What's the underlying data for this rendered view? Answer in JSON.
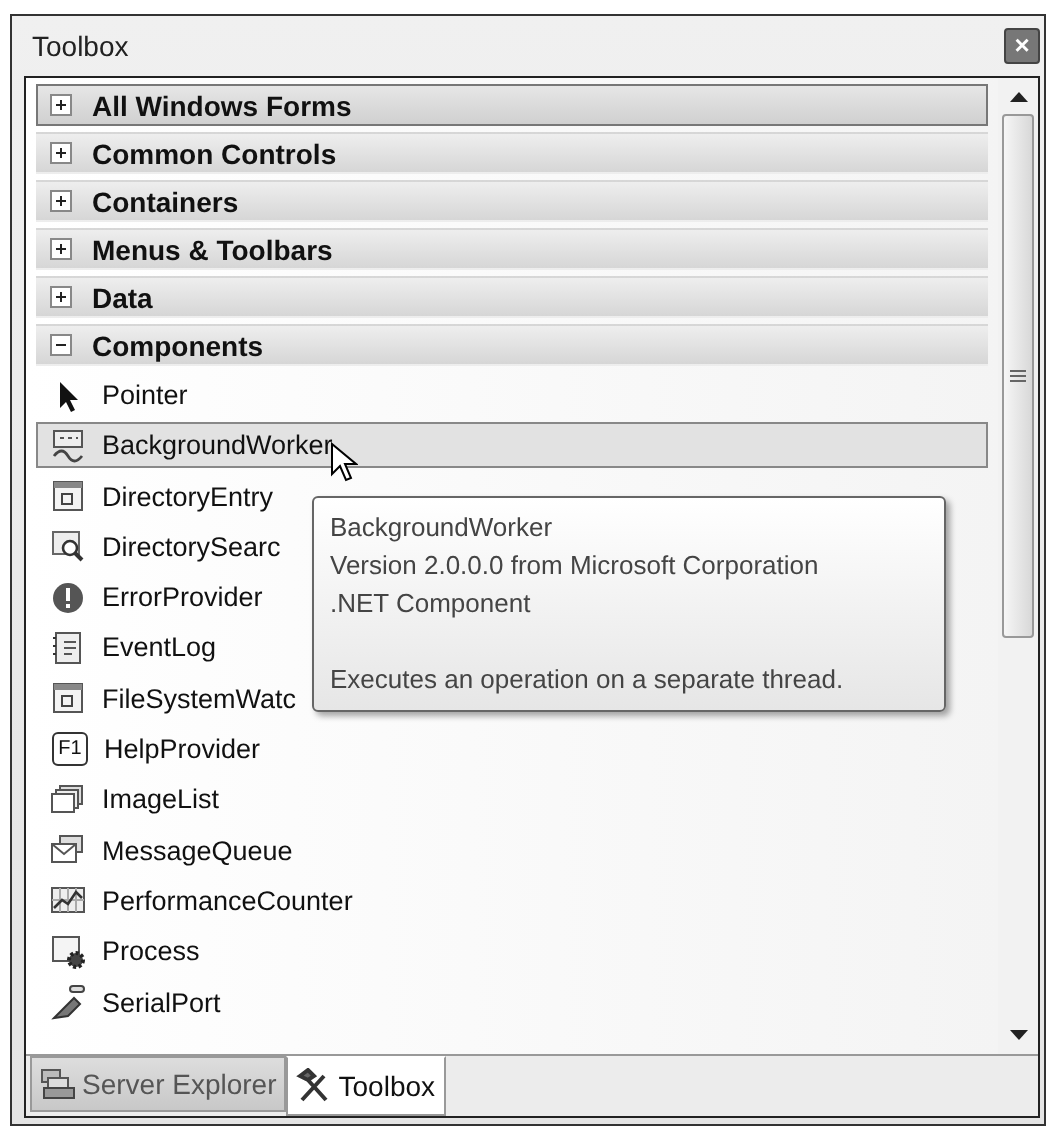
{
  "window": {
    "title": "Toolbox",
    "close_glyph": "×"
  },
  "categories": [
    {
      "label": "All Windows Forms",
      "expanded": false,
      "selected": true
    },
    {
      "label": "Common Controls",
      "expanded": false,
      "selected": false
    },
    {
      "label": "Containers",
      "expanded": false,
      "selected": false
    },
    {
      "label": "Menus & Toolbars",
      "expanded": false,
      "selected": false
    },
    {
      "label": "Data",
      "expanded": false,
      "selected": false
    },
    {
      "label": "Components",
      "expanded": true,
      "selected": false
    }
  ],
  "items": [
    {
      "label": "Pointer",
      "kind": "pointer",
      "selected": false
    },
    {
      "label": "BackgroundWorker",
      "kind": "worker",
      "selected": true
    },
    {
      "label": "DirectoryEntry",
      "kind": "window",
      "selected": false
    },
    {
      "label": "DirectorySearc",
      "kind": "search",
      "selected": false
    },
    {
      "label": "ErrorProvider",
      "kind": "error",
      "selected": false
    },
    {
      "label": "EventLog",
      "kind": "log",
      "selected": false
    },
    {
      "label": "FileSystemWatc",
      "kind": "window",
      "selected": false
    },
    {
      "label": "HelpProvider",
      "kind": "help",
      "selected": false
    },
    {
      "label": "ImageList",
      "kind": "stack",
      "selected": false
    },
    {
      "label": "MessageQueue",
      "kind": "mail",
      "selected": false
    },
    {
      "label": "PerformanceCounter",
      "kind": "chart",
      "selected": false
    },
    {
      "label": "Process",
      "kind": "gear",
      "selected": false
    },
    {
      "label": "SerialPort",
      "kind": "plug",
      "selected": false
    }
  ],
  "tooltip": {
    "lines": [
      "BackgroundWorker",
      "Version 2.0.0.0 from Microsoft Corporation",
      ".NET Component"
    ],
    "description": "Executes an operation on a separate thread."
  },
  "help_icon_text": "F1",
  "tabs": [
    {
      "label": "Server Explorer",
      "kind": "server",
      "selected": false
    },
    {
      "label": "Toolbox",
      "kind": "tools",
      "selected": true
    }
  ]
}
